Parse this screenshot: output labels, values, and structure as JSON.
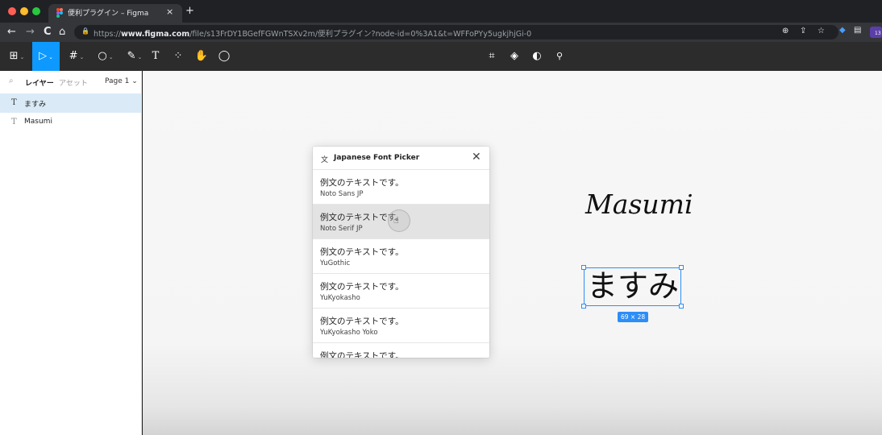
{
  "browser": {
    "tab": {
      "title": "便利プラグイン – Figma",
      "close": "×"
    },
    "new_tab": "+",
    "nav": {
      "back": "←",
      "forward": "→",
      "reload": "C",
      "home": "⌂"
    },
    "address": {
      "lock": "🔒",
      "prefix": "https://",
      "host": "www.figma.com",
      "path": "/file/s13FrDY1BGefFGWnTSXv2m/便利プラグイン?node-id=0%3A1&t=WFFoPYy5ugkjhjGi-0"
    },
    "right_icons": {
      "zoom": "⊕",
      "share": "⇪",
      "star": "☆"
    },
    "extension_badge": "13"
  },
  "toolbar": {
    "main_menu": "⊞",
    "move": "▷",
    "frame": "#",
    "shape": "○",
    "pen": "✎",
    "text": "T",
    "resources": "⁘",
    "hand": "✋",
    "comment": "◯",
    "caret": "⌄",
    "center": {
      "component": "⌗",
      "instance": "◈",
      "contrast": "◐",
      "link": "⚲"
    }
  },
  "layers_panel": {
    "search_icon": "⌕",
    "tab_layers": "レイヤー",
    "tab_assets": "アセット",
    "page": "Page 1 ⌄",
    "layers": [
      {
        "label": "ますみ",
        "icon": "T",
        "selected": true
      },
      {
        "label": "Masumi",
        "icon": "T",
        "selected": false
      }
    ]
  },
  "plugin": {
    "icon": "文",
    "title": "Japanese Font Picker",
    "close": "✕",
    "fonts": [
      {
        "sample": "例文のテキストです。",
        "name": "Noto Sans JP"
      },
      {
        "sample": "例文のテキストです。",
        "name": "Noto Serif JP"
      },
      {
        "sample": "例文のテキストです。",
        "name": "YuGothic"
      },
      {
        "sample": "例文のテキストです。",
        "name": "YuKyokasho"
      },
      {
        "sample": "例文のテキストです。",
        "name": "YuKyokasho Yoko"
      },
      {
        "sample": "例文のテキストです。",
        "name": ""
      }
    ],
    "cursor": "☝"
  },
  "canvas": {
    "text_latin": "Masumi",
    "text_jp": "ますみ",
    "dimensions": "69 × 28"
  },
  "colors": {
    "accent": "#0d99ff",
    "selection": "#2d8ef7",
    "toolbar": "#2c2c2c",
    "layer_selected": "#daebf7"
  }
}
